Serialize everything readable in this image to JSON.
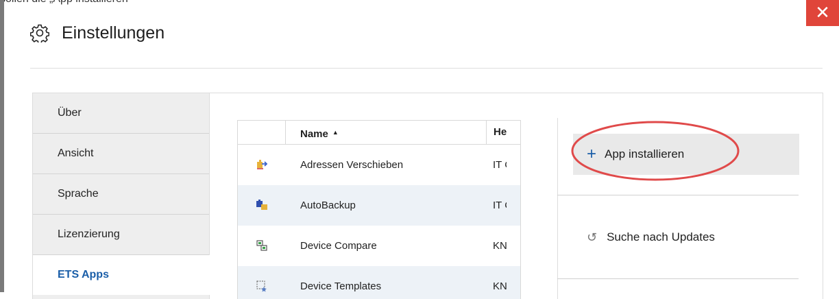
{
  "caption": "sollen die „App installieren“",
  "window": {
    "title": "Einstellungen",
    "close_glyph": "✕",
    "accent_color": "#1a5ea8",
    "close_color": "#e0453a"
  },
  "sidebar": {
    "items": [
      {
        "label": "Über",
        "active": false
      },
      {
        "label": "Ansicht",
        "active": false
      },
      {
        "label": "Sprache",
        "active": false
      },
      {
        "label": "Lizenzierung",
        "active": false
      },
      {
        "label": "ETS Apps",
        "active": true
      }
    ]
  },
  "apps_table": {
    "columns": {
      "name": "Name",
      "sort_glyph": "▲",
      "manufacturer": "He"
    },
    "rows": [
      {
        "icon": "puzzle-arrows-icon",
        "name": "Adressen Verschieben",
        "manufacturer": "IT C"
      },
      {
        "icon": "puzzle-folder-icon",
        "name": "AutoBackup",
        "manufacturer": "IT C"
      },
      {
        "icon": "compare-devices-icon",
        "name": "Device Compare",
        "manufacturer": "KN"
      },
      {
        "icon": "device-template-icon",
        "name": "Device Templates",
        "manufacturer": "KN"
      }
    ]
  },
  "actions": {
    "install_plus": "+",
    "install_label": "App installieren",
    "updates_glyph": "↺",
    "updates_label": "Suche nach Updates"
  },
  "annotation": {
    "shape": "ellipse",
    "color": "#e04a4a"
  }
}
